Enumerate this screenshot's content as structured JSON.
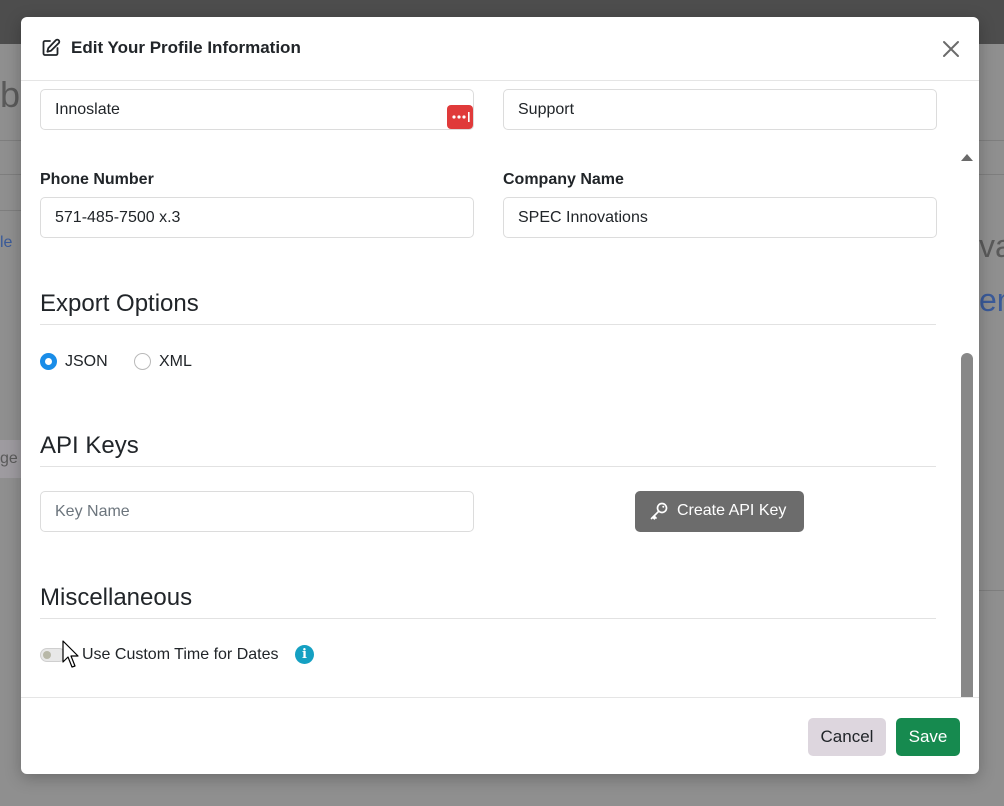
{
  "background": {
    "fragments": [
      "b",
      "le",
      "ge",
      "va",
      "em"
    ]
  },
  "modal": {
    "title": "Edit Your Profile Information",
    "close_icon": "close-icon",
    "edit_icon": "edit-icon"
  },
  "form": {
    "row1": {
      "left_value": "Innoslate",
      "right_value": "Support"
    },
    "phone": {
      "label": "Phone Number",
      "value": "571-485-7500 x.3"
    },
    "company": {
      "label": "Company Name",
      "value": "SPEC Innovations"
    }
  },
  "export_options": {
    "title": "Export Options",
    "options": [
      "JSON",
      "XML"
    ],
    "selected": "JSON"
  },
  "api_keys": {
    "title": "API Keys",
    "key_name_placeholder": "Key Name",
    "create_label": "Create API Key"
  },
  "misc": {
    "title": "Miscellaneous",
    "toggle_label": "Use Custom Time for Dates",
    "toggle_on": false,
    "info_glyph": "i"
  },
  "footer": {
    "cancel_label": "Cancel",
    "save_label": "Save"
  },
  "colors": {
    "save": "#168a4f",
    "cancel": "#ddd6de",
    "api_button": "#6c6c6c",
    "radio_selected": "#1a8de8",
    "info": "#14a0c2",
    "password_manager_badge": "#e03a3a"
  }
}
